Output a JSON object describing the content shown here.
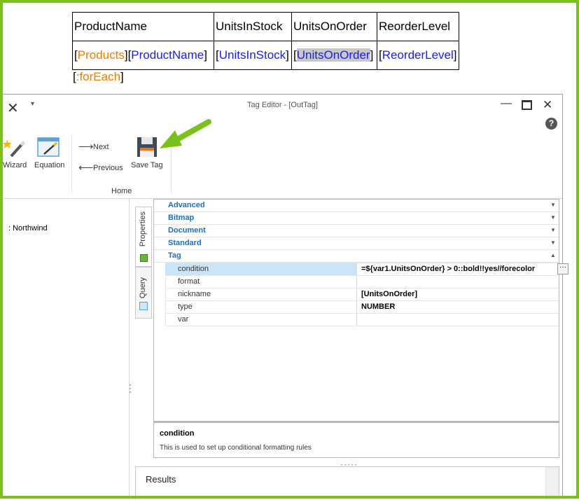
{
  "document": {
    "table": {
      "headers": [
        "ProductName",
        "UnitsInStock",
        "UnitsOnOrder",
        "ReorderLevel"
      ],
      "row": {
        "products": "Products",
        "product_name": "ProductName",
        "units_in_stock": "UnitsInStock",
        "units_on_order": "UnitsOnOrder",
        "reorder_level": "ReorderLevel"
      }
    },
    "foreach_tag": ":forEach",
    "bracket_open": "[",
    "bracket_close": "]"
  },
  "window": {
    "title": "Tag Editor - [OutTag]",
    "quick_access": "▾",
    "help": "?"
  },
  "ribbon": {
    "wizard_label": "Wizard",
    "equation_label": "Equation",
    "next_label": "Next",
    "previous_label": "Previous",
    "save_tag_label": "Save Tag",
    "group_label": "Home"
  },
  "tree": {
    "datasource_label": ": Northwind"
  },
  "side_tabs": {
    "properties_label": "Properties",
    "query_label": "Query"
  },
  "property_grid": {
    "categories": [
      {
        "label": "Advanced",
        "expanded": false
      },
      {
        "label": "Bitmap",
        "expanded": false
      },
      {
        "label": "Document",
        "expanded": false
      },
      {
        "label": "Standard",
        "expanded": false
      },
      {
        "label": "Tag",
        "expanded": true
      }
    ],
    "tag_properties": [
      {
        "name": "condition",
        "value": "=${var1.UnitsOnOrder} > 0::bold!!yes//forecolor",
        "selected": true
      },
      {
        "name": "format",
        "value": ""
      },
      {
        "name": "nickname",
        "value": "[UnitsOnOrder]"
      },
      {
        "name": "type",
        "value": "NUMBER"
      },
      {
        "name": "var",
        "value": ""
      }
    ],
    "ellipsis": "···"
  },
  "description": {
    "title": "condition",
    "text": "This is used to set up conditional formatting rules"
  },
  "results": {
    "label": "Results"
  },
  "colors": {
    "frame": "#7cc11a",
    "arrow": "#7cc11a",
    "category_text": "#1e6fb8",
    "tag_name_orange": "#e67e00",
    "field_blue": "#1a1aff",
    "selection": "#cce4f7"
  }
}
